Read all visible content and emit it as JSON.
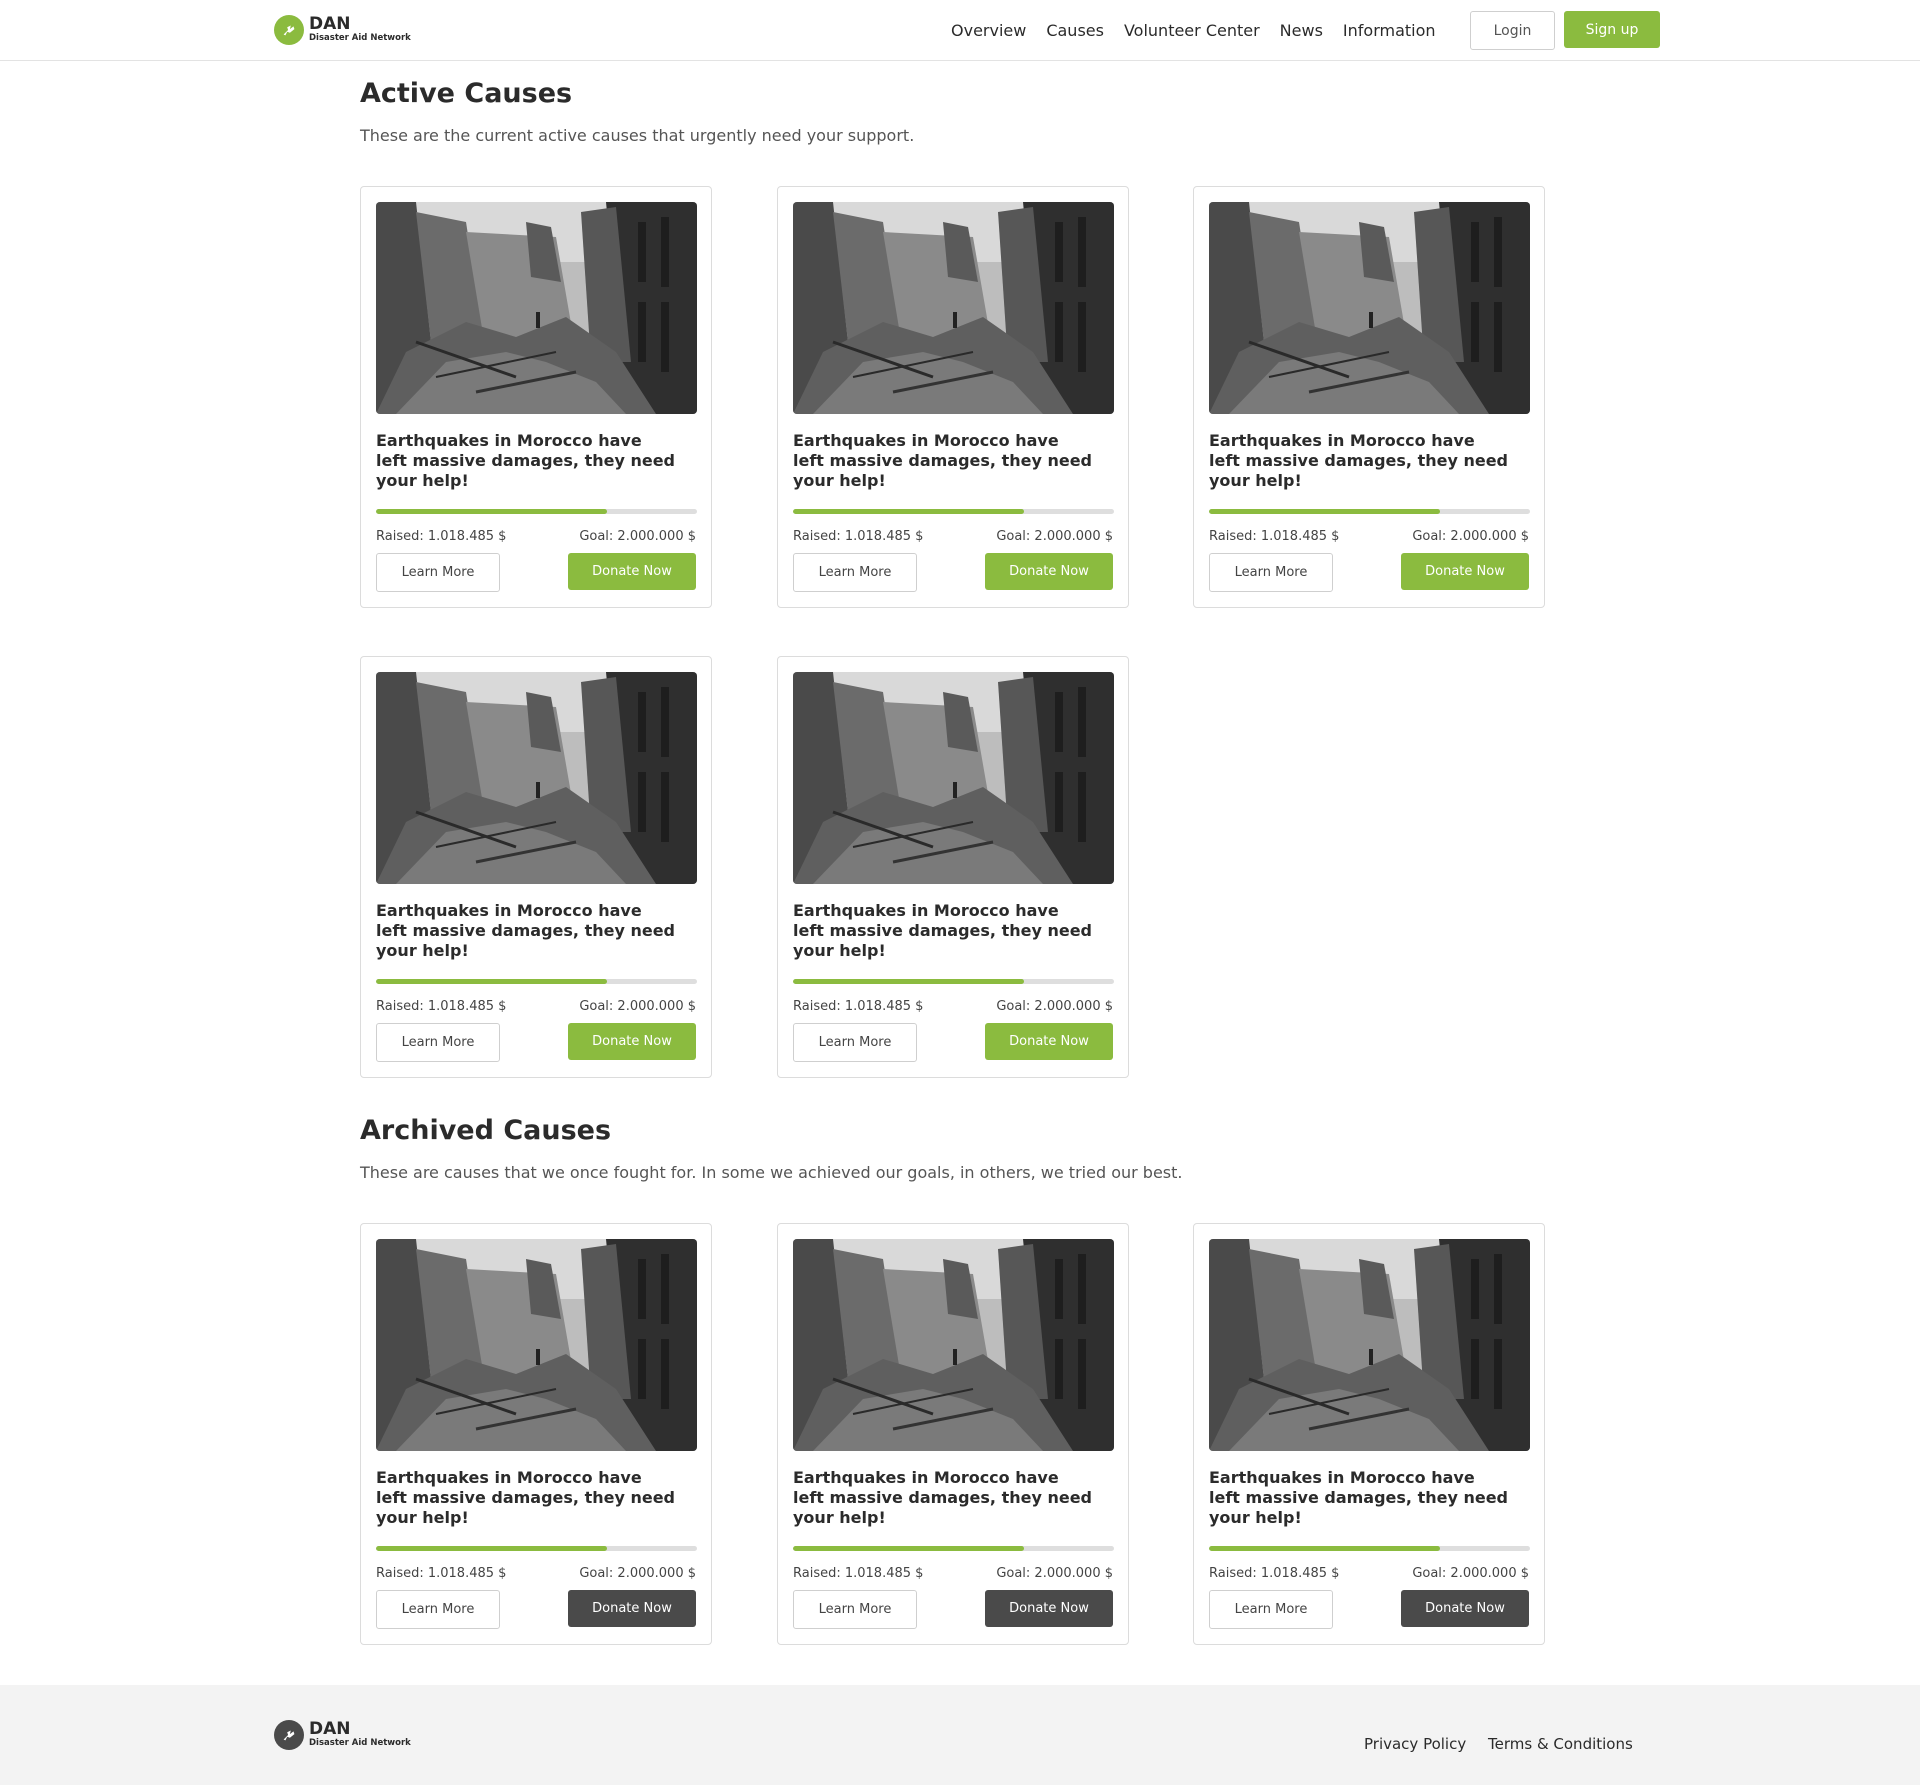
{
  "header": {
    "logo_name": "DAN",
    "logo_tagline": "Disaster Aid Network",
    "nav": [
      "Overview",
      "Causes",
      "Volunteer Center",
      "News",
      "Information"
    ],
    "login_label": "Login",
    "signup_label": "Sign up"
  },
  "colors": {
    "accent": "#8bbb3f",
    "archived_button": "#4a4a4a",
    "footer_logo": "#4a4a4a"
  },
  "active": {
    "title": "Active Causes",
    "description": "These are the current active causes that urgently need your support.",
    "cards": [
      {
        "title": "Earthquakes in Morocco have left massive damages, they need your help!",
        "raised": "Raised: 1.018.485 $",
        "goal": "Goal: 2.000.000 $",
        "progress": 0.72,
        "learn": "Learn More",
        "donate": "Donate Now"
      },
      {
        "title": "Earthquakes in Morocco have left massive damages, they need your help!",
        "raised": "Raised: 1.018.485 $",
        "goal": "Goal: 2.000.000 $",
        "progress": 0.72,
        "learn": "Learn More",
        "donate": "Donate Now"
      },
      {
        "title": "Earthquakes in Morocco have left massive damages, they need your help!",
        "raised": "Raised: 1.018.485 $",
        "goal": "Goal: 2.000.000 $",
        "progress": 0.72,
        "learn": "Learn More",
        "donate": "Donate Now"
      },
      {
        "title": "Earthquakes in Morocco have left massive damages, they need your help!",
        "raised": "Raised: 1.018.485 $",
        "goal": "Goal: 2.000.000 $",
        "progress": 0.72,
        "learn": "Learn More",
        "donate": "Donate Now"
      },
      {
        "title": "Earthquakes in Morocco have left massive damages, they need your help!",
        "raised": "Raised: 1.018.485 $",
        "goal": "Goal: 2.000.000 $",
        "progress": 0.72,
        "learn": "Learn More",
        "donate": "Donate Now"
      }
    ]
  },
  "archived": {
    "title": "Archived Causes",
    "description": "These are causes that we once fought for. In some we achieved our goals, in others, we tried our best.",
    "cards": [
      {
        "title": "Earthquakes in Morocco have left massive damages, they need your help!",
        "raised": "Raised: 1.018.485 $",
        "goal": "Goal: 2.000.000 $",
        "progress": 0.72,
        "learn": "Learn More",
        "donate": "Donate Now"
      },
      {
        "title": "Earthquakes in Morocco have left massive damages, they need your help!",
        "raised": "Raised: 1.018.485 $",
        "goal": "Goal: 2.000.000 $",
        "progress": 0.72,
        "learn": "Learn More",
        "donate": "Donate Now"
      },
      {
        "title": "Earthquakes in Morocco have left massive damages, they need your help!",
        "raised": "Raised: 1.018.485 $",
        "goal": "Goal: 2.000.000 $",
        "progress": 0.72,
        "learn": "Learn More",
        "donate": "Donate Now"
      }
    ]
  },
  "footer": {
    "logo_name": "DAN",
    "logo_tagline": "Disaster Aid Network",
    "links": [
      "Privacy Policy",
      "Terms & Conditions"
    ]
  }
}
